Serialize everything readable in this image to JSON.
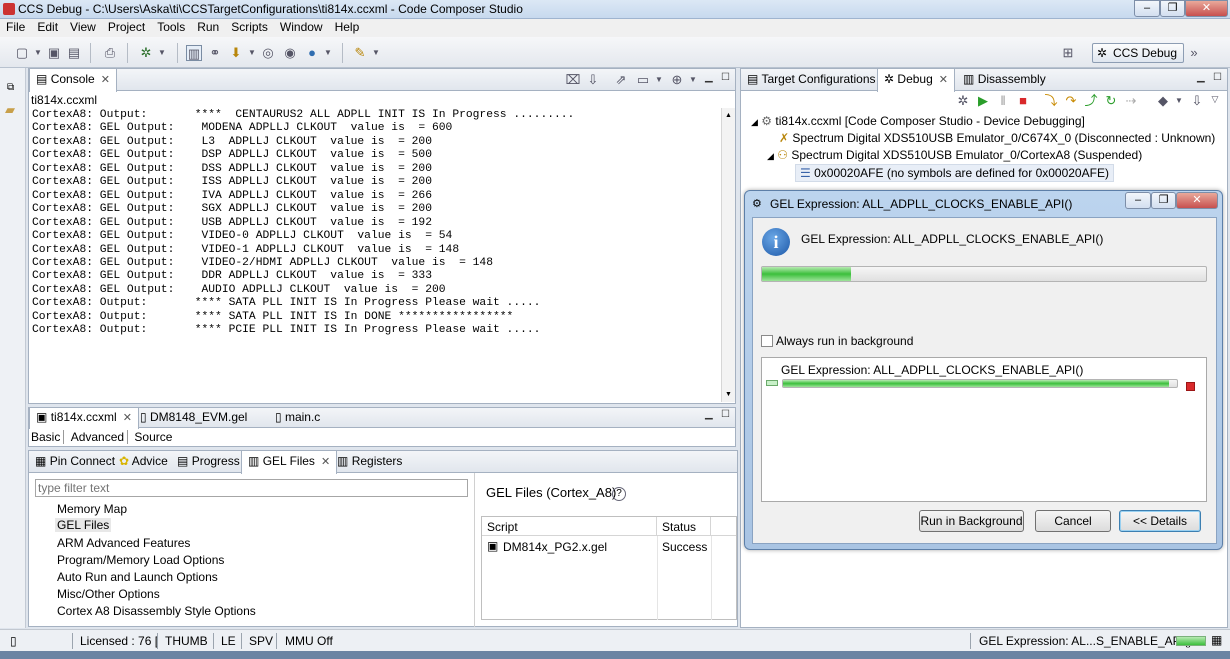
{
  "window": {
    "title": "CCS Debug - C:\\Users\\Aska\\ti\\CCSTargetConfigurations\\ti814x.ccxml - Code Composer Studio",
    "controls": [
      "–",
      "❐",
      "✕"
    ]
  },
  "menu": [
    "File",
    "Edit",
    "View",
    "Project",
    "Tools",
    "Run",
    "Scripts",
    "Window",
    "Help"
  ],
  "perspective": {
    "label": "CCS Debug"
  },
  "console": {
    "tab": "Console",
    "header": "ti814x.ccxml",
    "lines": [
      "CortexA8: Output:       ****  CENTAURUS2 ALL ADPLL INIT IS In Progress .........",
      "CortexA8: GEL Output:    MODENA ADPLLJ CLKOUT  value is  = 600",
      "CortexA8: GEL Output:    L3  ADPLLJ CLKOUT  value is  = 200",
      "CortexA8: GEL Output:    DSP ADPLLJ CLKOUT  value is  = 500",
      "CortexA8: GEL Output:    DSS ADPLLJ CLKOUT  value is  = 200",
      "CortexA8: GEL Output:    ISS ADPLLJ CLKOUT  value is  = 200",
      "CortexA8: GEL Output:    IVA ADPLLJ CLKOUT  value is  = 266",
      "CortexA8: GEL Output:    SGX ADPLLJ CLKOUT  value is  = 200",
      "CortexA8: GEL Output:    USB ADPLLJ CLKOUT  value is  = 192",
      "CortexA8: GEL Output:    VIDEO-0 ADPLLJ CLKOUT  value is  = 54",
      "CortexA8: GEL Output:    VIDEO-1 ADPLLJ CLKOUT  value is  = 148",
      "CortexA8: GEL Output:    VIDEO-2/HDMI ADPLLJ CLKOUT  value is  = 148",
      "CortexA8: GEL Output:    DDR ADPLLJ CLKOUT  value is  = 333",
      "CortexA8: GEL Output:    AUDIO ADPLLJ CLKOUT  value is  = 200",
      "CortexA8: Output:       **** SATA PLL INIT IS In Progress Please wait .....",
      "CortexA8: Output:       **** SATA PLL INIT IS In DONE *****************",
      "CortexA8: Output:       **** PCIE PLL INIT IS In Progress Please wait ....."
    ]
  },
  "editor": {
    "tabs": [
      "ti814x.ccxml",
      "DM8148_EVM.gel",
      "main.c"
    ],
    "subtabs": [
      "Basic",
      "Advanced",
      "Source"
    ]
  },
  "bottom": {
    "tabs": [
      "Pin Connect",
      "Advice",
      "Progress",
      "GEL Files",
      "Registers"
    ],
    "filter_placeholder": "type filter text",
    "tree": [
      "Memory Map",
      "GEL Files",
      "ARM Advanced Features",
      "Program/Memory Load Options",
      "Auto Run and Launch Options",
      "Misc/Other Options",
      "Cortex A8 Disassembly Style Options"
    ],
    "gel_title": "GEL Files (Cortex_A8)",
    "help": "?",
    "table_headers": [
      "Script",
      "Status"
    ],
    "table_rows": [
      {
        "script": "DM814x_PG2.x.gel",
        "status": "Success"
      }
    ]
  },
  "debug": {
    "tabs": [
      "Target Configurations",
      "Debug",
      "Disassembly"
    ],
    "tree": [
      "ti814x.ccxml [Code Composer Studio - Device Debugging]",
      "Spectrum Digital XDS510USB Emulator_0/C674X_0 (Disconnected : Unknown)",
      "Spectrum Digital XDS510USB Emulator_0/CortexA8 (Suspended)",
      "0x00020AFE  (no symbols are defined for 0x00020AFE)"
    ]
  },
  "dialog": {
    "title": "GEL Expression: ALL_ADPLL_CLOCKS_ENABLE_API()",
    "message": "GEL Expression: ALL_ADPLL_CLOCKS_ENABLE_API()",
    "progress_main": 0.2,
    "always_background": "Always run in background",
    "job_label": "GEL Expression: ALL_ADPLL_CLOCKS_ENABLE_API()",
    "job_progress": 0.98,
    "buttons": {
      "background": "Run in Background",
      "cancel": "Cancel",
      "details": "<< Details"
    }
  },
  "status": {
    "license": "Licensed : 76 [",
    "mode": "THUMB",
    "endian": "LE",
    "spv": "SPV",
    "mmu": "MMU Off",
    "job": "GEL Expression: AL...S_ENABLE_API()"
  },
  "colors": {
    "progress": "#3cbf3c",
    "stop": "#d9292b"
  }
}
